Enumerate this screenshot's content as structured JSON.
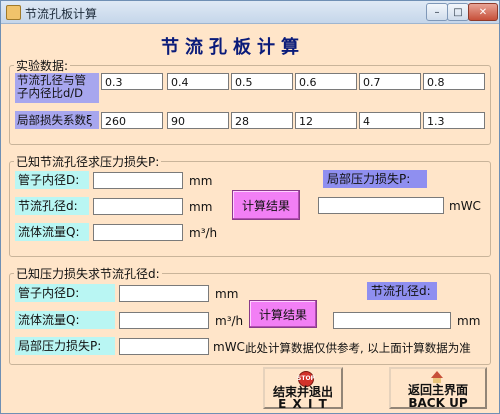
{
  "window": {
    "title": "节流孔板计算",
    "minimize": "–",
    "maximize": "□",
    "close": "✕"
  },
  "main_title": "节流孔板计算",
  "experiment": {
    "legend": "实验数据:",
    "ratio_label": "节流孔径与管子内径比d/D",
    "ratios": [
      "0.3",
      "0.4",
      "0.5",
      "0.6",
      "0.7",
      "0.8"
    ],
    "loss_label": "局部损失系数ξ",
    "losses": [
      "260",
      "90",
      "28",
      "12",
      "4",
      "1.3"
    ]
  },
  "section1": {
    "legend": "已知节流孔径求压力损失P:",
    "pipe_diameter_label": "管子内径D:",
    "pipe_diameter_value": "",
    "pipe_diameter_unit": "mm",
    "orifice_diameter_label": "节流孔径d:",
    "orifice_diameter_value": "",
    "orifice_diameter_unit": "mm",
    "flow_label": "流体流量Q:",
    "flow_value": "",
    "flow_unit": "m³/h",
    "result_label": "局部压力损失P:",
    "result_value": "",
    "result_unit": "mWC",
    "calc_button": "计算结果"
  },
  "section2": {
    "legend": "已知压力损失求节流孔径d:",
    "pipe_diameter_label": "管子内径D:",
    "pipe_diameter_value": "",
    "pipe_diameter_unit": "mm",
    "flow_label": "流体流量Q:",
    "flow_value": "",
    "flow_unit": "m³/h",
    "loss_label": "局部压力损失P:",
    "loss_value": "",
    "loss_unit": "mWC",
    "result_label": "节流孔径d:",
    "result_value": "",
    "result_unit": "mm",
    "calc_button": "计算结果",
    "note": "此处计算数据仅供参考, 以上面计算数据为准"
  },
  "buttons": {
    "exit_icon_text": "STOP",
    "exit_line1": "结束并退出",
    "exit_line2": "E X I T",
    "back_line1": "返回主界面",
    "back_line2": "BACK UP"
  }
}
